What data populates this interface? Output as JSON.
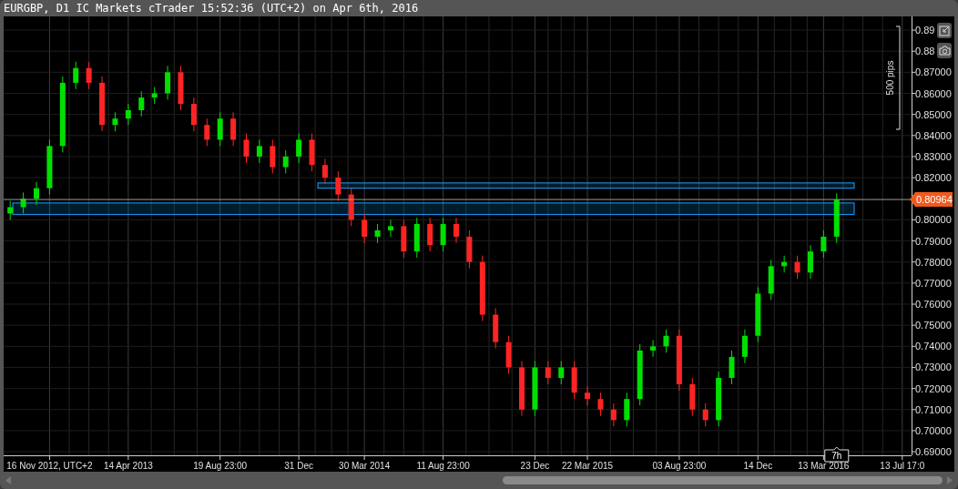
{
  "window": {
    "title": "EURGBP, D1 IC Markets cTrader 15:52:36 (UTC+2) on Apr 6th, 2016"
  },
  "chart": {
    "chart_data": {
      "type": "candlestick",
      "grid": true,
      "ylim": [
        0.6883,
        0.8965
      ],
      "categories": [
        null,
        null,
        null,
        "16 Nov 2012, UTC+2",
        null,
        null,
        null,
        null,
        null,
        "14 Apr 2013",
        null,
        null,
        null,
        null,
        null,
        null,
        "19 Aug 23:00",
        null,
        null,
        null,
        null,
        null,
        "31 Dec",
        null,
        null,
        null,
        null,
        "30 Mar 2014",
        null,
        null,
        null,
        null,
        null,
        "11 Aug 23:00",
        null,
        null,
        null,
        null,
        null,
        null,
        "23 Dec",
        null,
        null,
        null,
        "22 Mar 2015",
        null,
        null,
        null,
        null,
        null,
        null,
        "03 Aug 23:00",
        null,
        null,
        null,
        null,
        null,
        "14 Dec",
        null,
        null,
        null,
        null,
        "13 Mar 2016",
        null,
        null,
        null,
        null,
        null,
        "13 Jul 17:0"
      ],
      "ohlc": [
        [
          0.803,
          0.809,
          0.8,
          0.806
        ],
        [
          0.806,
          0.813,
          0.803,
          0.81
        ],
        [
          0.81,
          0.818,
          0.807,
          0.815
        ],
        [
          0.815,
          0.838,
          0.812,
          0.835
        ],
        [
          0.835,
          0.868,
          0.832,
          0.865
        ],
        [
          0.865,
          0.875,
          0.862,
          0.872
        ],
        [
          0.872,
          0.875,
          0.862,
          0.865
        ],
        [
          0.865,
          0.868,
          0.842,
          0.845
        ],
        [
          0.845,
          0.851,
          0.842,
          0.848
        ],
        [
          0.848,
          0.855,
          0.845,
          0.852
        ],
        [
          0.852,
          0.861,
          0.849,
          0.858
        ],
        [
          0.858,
          0.863,
          0.855,
          0.86
        ],
        [
          0.86,
          0.873,
          0.857,
          0.87
        ],
        [
          0.87,
          0.873,
          0.852,
          0.855
        ],
        [
          0.855,
          0.858,
          0.842,
          0.845
        ],
        [
          0.845,
          0.848,
          0.835,
          0.838
        ],
        [
          0.838,
          0.851,
          0.835,
          0.848
        ],
        [
          0.848,
          0.851,
          0.835,
          0.838
        ],
        [
          0.838,
          0.841,
          0.827,
          0.83
        ],
        [
          0.83,
          0.838,
          0.827,
          0.835
        ],
        [
          0.835,
          0.838,
          0.822,
          0.825
        ],
        [
          0.825,
          0.833,
          0.822,
          0.83
        ],
        [
          0.83,
          0.841,
          0.827,
          0.838
        ],
        [
          0.838,
          0.841,
          0.823,
          0.826
        ],
        [
          0.826,
          0.829,
          0.817,
          0.82
        ],
        [
          0.82,
          0.823,
          0.809,
          0.812
        ],
        [
          0.812,
          0.815,
          0.797,
          0.8
        ],
        [
          0.8,
          0.803,
          0.789,
          0.792
        ],
        [
          0.792,
          0.798,
          0.789,
          0.795
        ],
        [
          0.795,
          0.8,
          0.792,
          0.797
        ],
        [
          0.797,
          0.8,
          0.782,
          0.785
        ],
        [
          0.785,
          0.801,
          0.782,
          0.798
        ],
        [
          0.798,
          0.801,
          0.785,
          0.788
        ],
        [
          0.788,
          0.801,
          0.785,
          0.798
        ],
        [
          0.798,
          0.801,
          0.789,
          0.792
        ],
        [
          0.792,
          0.795,
          0.777,
          0.78
        ],
        [
          0.78,
          0.783,
          0.752,
          0.755
        ],
        [
          0.755,
          0.758,
          0.739,
          0.742
        ],
        [
          0.742,
          0.745,
          0.727,
          0.73
        ],
        [
          0.73,
          0.733,
          0.707,
          0.71
        ],
        [
          0.71,
          0.733,
          0.707,
          0.73
        ],
        [
          0.73,
          0.733,
          0.722,
          0.725
        ],
        [
          0.725,
          0.733,
          0.722,
          0.73
        ],
        [
          0.73,
          0.733,
          0.715,
          0.718
        ],
        [
          0.718,
          0.721,
          0.712,
          0.715
        ],
        [
          0.715,
          0.718,
          0.707,
          0.71
        ],
        [
          0.71,
          0.713,
          0.702,
          0.705
        ],
        [
          0.705,
          0.718,
          0.702,
          0.715
        ],
        [
          0.715,
          0.741,
          0.712,
          0.738
        ],
        [
          0.738,
          0.743,
          0.735,
          0.74
        ],
        [
          0.74,
          0.748,
          0.737,
          0.745
        ],
        [
          0.745,
          0.748,
          0.719,
          0.722
        ],
        [
          0.722,
          0.725,
          0.707,
          0.71
        ],
        [
          0.71,
          0.713,
          0.702,
          0.705
        ],
        [
          0.705,
          0.728,
          0.702,
          0.725
        ],
        [
          0.725,
          0.738,
          0.722,
          0.735
        ],
        [
          0.735,
          0.748,
          0.732,
          0.745
        ],
        [
          0.745,
          0.768,
          0.742,
          0.765
        ],
        [
          0.765,
          0.781,
          0.762,
          0.778
        ],
        [
          0.778,
          0.783,
          0.775,
          0.78
        ],
        [
          0.78,
          0.783,
          0.772,
          0.775
        ],
        [
          0.775,
          0.788,
          0.772,
          0.785
        ],
        [
          0.785,
          0.795,
          0.782,
          0.792
        ],
        [
          0.792,
          0.8126,
          0.789,
          0.8096
        ],
        null,
        null,
        null,
        null,
        null
      ],
      "yticks": [
        {
          "value": 0.89,
          "label": "0.89"
        },
        {
          "value": 0.88,
          "label": "0.88"
        },
        {
          "value": 0.87,
          "label": "0.87000"
        },
        {
          "value": 0.86,
          "label": "0.86000"
        },
        {
          "value": 0.85,
          "label": "0.85000"
        },
        {
          "value": 0.84,
          "label": "0.84000"
        },
        {
          "value": 0.83,
          "label": "0.83000"
        },
        {
          "value": 0.82,
          "label": "0.82000"
        },
        {
          "value": 0.8,
          "label": "0.80000"
        },
        {
          "value": 0.79,
          "label": "0.79000"
        },
        {
          "value": 0.78,
          "label": "0.78000"
        },
        {
          "value": 0.77,
          "label": "0.77000"
        },
        {
          "value": 0.76,
          "label": "0.76000"
        },
        {
          "value": 0.75,
          "label": "0.75000"
        },
        {
          "value": 0.74,
          "label": "0.74000"
        },
        {
          "value": 0.73,
          "label": "0.73000"
        },
        {
          "value": 0.72,
          "label": "0.72000"
        },
        {
          "value": 0.71,
          "label": "0.71000"
        },
        {
          "value": 0.7,
          "label": "0.70000"
        },
        {
          "value": 0.69,
          "label": "0.69000"
        }
      ],
      "bands": [
        {
          "axis": "y",
          "from": 0.815,
          "to": 0.8175
        },
        {
          "axis": "y",
          "from": 0.8025,
          "to": 0.808
        }
      ],
      "ref_lines": [
        {
          "axis": "y",
          "value": 0.80964,
          "label": "0.80964"
        }
      ]
    },
    "range_label": "500 pips",
    "cursor_label": "7h"
  }
}
